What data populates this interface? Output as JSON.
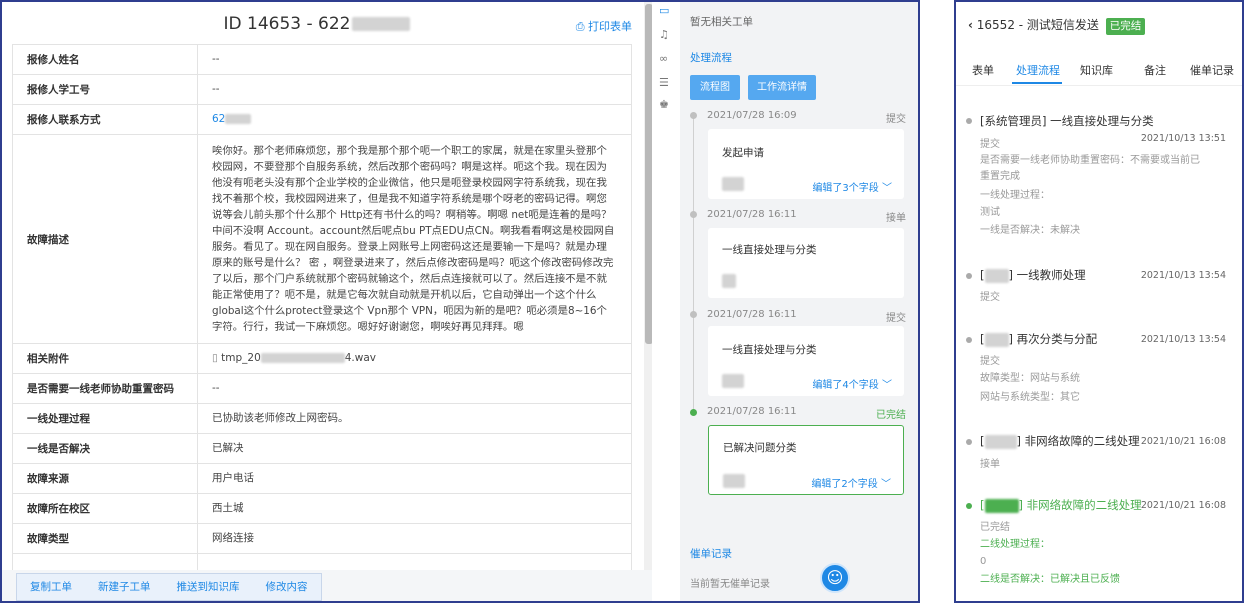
{
  "ticket": {
    "title": "ID 14653 - 622",
    "print_label": "打印表单",
    "rows": [
      {
        "label": "报修人姓名",
        "value": "--"
      },
      {
        "label": "报修人学工号",
        "value": "--"
      },
      {
        "label": "报修人联系方式",
        "value": "62"
      },
      {
        "label": "故障描述",
        "value": "唉你好。那个老师麻烦您，那个我是那个那个呃一个职工的家属，就是在家里头登那个校园网，不要登那个自服务系统，然后改那个密码吗？啊是这样。呃这个我。现在因为他没有呃老头没有那个企业学校的企业微信，他只是呃登录校园网字符系统我，现在我找不着那个校，我校园网进来了，但是我不知道字符系统是哪个呀老的密码记得。啊您说等会儿前头那个什么那个 Http还有书什么的吗？啊稍等。啊嗯 net呃是连着的是吗？中间不没啊 Account。account然后呢点bu PT点EDU点CN。啊我看看啊这是校园网自服务。看见了。现在网自服务。登录上网账号上网密码这还是要输一下是吗？就是办理原来的账号是什么？ 密 ，啊登录进来了，然后点修改密码是吗？呃这个修改密码修改完了以后，那个门户系统就那个密码就输这个，然后点连接就可以了。然后连接不是不就能正常使用了？呃不是，就是它每次就自动就是开机以后，它自动弹出一个这个什么global这个什么protect登录这个 Vpn那个 VPN，呃因为新的是吧？呃必须是8~16个字符。行行，我试一下麻烦您。嗯好好谢谢您，啊唉好再见拜拜。嗯"
      },
      {
        "label": "相关附件",
        "value": "tmp_20",
        "value_suffix": "4.wav"
      },
      {
        "label": "是否需要一线老师协助重置密码",
        "value": "--"
      },
      {
        "label": "一线处理过程",
        "value": "已协助该老师修改上网密码。"
      },
      {
        "label": "一线是否解决",
        "value": "已解决"
      },
      {
        "label": "故障来源",
        "value": "用户电话"
      },
      {
        "label": "故障所在校区",
        "value": "西土城"
      },
      {
        "label": "故障类型",
        "value": "网络连接"
      }
    ],
    "buttons": [
      "复制工单",
      "新建子工单",
      "推送到知识库",
      "修改内容"
    ]
  },
  "flow": {
    "no_related": "暂无相关工单",
    "section_title": "处理流程",
    "btn_flowchart": "流程图",
    "btn_workflow": "工作流详情",
    "steps": [
      {
        "time": "2021/07/28 16:09",
        "tag": "提交",
        "title": "发起申请",
        "edit": "编辑了3个字段"
      },
      {
        "time": "2021/07/28 16:11",
        "tag": "接单",
        "title": "一线直接处理与分类",
        "edit": ""
      },
      {
        "time": "2021/07/28 16:11",
        "tag": "提交",
        "title": "一线直接处理与分类",
        "edit": "编辑了4个字段"
      },
      {
        "time": "2021/07/28 16:11",
        "tag": "已完结",
        "title": "已解决问题分类",
        "edit": "编辑了2个字段"
      }
    ],
    "nudge_title": "催单记录",
    "nudge_empty": "当前暂无催单记录"
  },
  "mobile": {
    "title": "16552 - 测试短信发送",
    "status": "已完结",
    "tabs": [
      "表单",
      "处理流程",
      "知识库",
      "备注",
      "催单记录"
    ],
    "entries": [
      {
        "title": "[系统管理员] 一线直接处理与分类",
        "time": "2021/10/13 13:51",
        "lines": [
          "提交",
          "是否需要一线老师协助重置密码：不需要或当前已",
          "重置完成",
          "一线处理过程：",
          "测试",
          "一线是否解决：未解决"
        ]
      },
      {
        "title": "一线教师处理",
        "time": "2021/10/13 13:54",
        "lines": [
          "提交"
        ]
      },
      {
        "title": "再次分类与分配",
        "time": "2021/10/13 13:54",
        "lines": [
          "提交",
          "故障类型：网站与系统",
          "网站与系统类型：其它"
        ]
      },
      {
        "title": "非网络故障的二线处理",
        "time": "2021/10/21 16:08",
        "lines": [
          "接单"
        ]
      },
      {
        "title": "非网络故障的二线处理",
        "time": "2021/10/21 16:08",
        "lines": [
          "已完结",
          "二线处理过程：",
          "0",
          "二线是否解决：已解决且已反馈"
        ]
      }
    ]
  },
  "colors": {
    "accent": "#1e88e5",
    "success": "#4caf50",
    "frame": "#2f3e8f"
  }
}
